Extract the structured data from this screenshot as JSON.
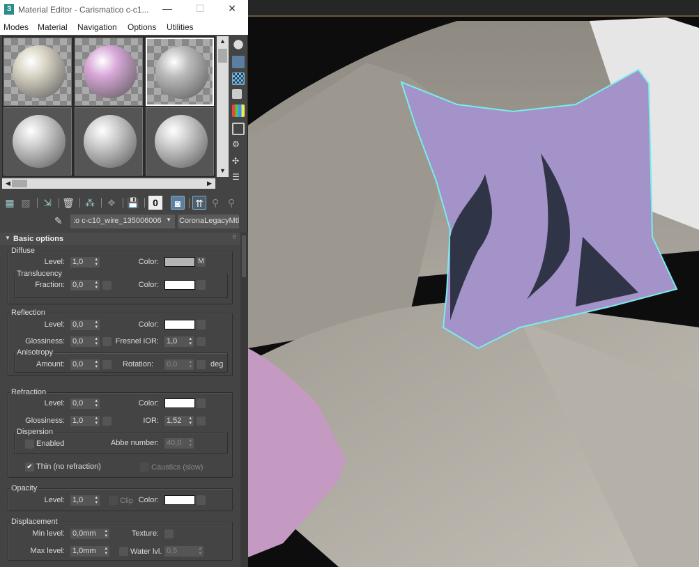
{
  "window": {
    "app_icon": "3",
    "title": "Material Editor - Carismatico c-c1...",
    "minimize": "—",
    "maximize": "☐",
    "close": "✕"
  },
  "menu": [
    "Modes",
    "Material",
    "Navigation",
    "Options",
    "Utilities"
  ],
  "slots": [
    {
      "color": "#d8d4c4"
    },
    {
      "color": "#d8a8d8"
    },
    {
      "color": "#bbbbbb"
    },
    {
      "color": "#cfcfcf"
    },
    {
      "color": "#cfcfcf"
    },
    {
      "color": "#cfcfcf"
    }
  ],
  "material": {
    "name": ":o c-c10_wire_135006006",
    "type": "CoronaLegacyMtl"
  },
  "rollout": {
    "title": "Basic options"
  },
  "diffuse": {
    "title": "Diffuse",
    "level_label": "Level:",
    "level": "1,0",
    "color_label": "Color:",
    "color": "#b4b4b4",
    "map_button": "M",
    "translucency": {
      "title": "Translucency",
      "fraction_label": "Fraction:",
      "fraction": "0,0",
      "color_label": "Color:",
      "color": "#ffffff"
    }
  },
  "reflection": {
    "title": "Reflection",
    "level_label": "Level:",
    "level": "0,0",
    "color_label": "Color:",
    "color": "#ffffff",
    "glossiness_label": "Glossiness:",
    "glossiness": "0,0",
    "fresnel_label": "Fresnel IOR:",
    "fresnel": "1,0",
    "anisotropy": {
      "title": "Anisotropy",
      "amount_label": "Amount:",
      "amount": "0,0",
      "rotation_label": "Rotation:",
      "rotation": "0,0",
      "unit": "deg"
    }
  },
  "refraction": {
    "title": "Refraction",
    "level_label": "Level:",
    "level": "0,0",
    "color_label": "Color:",
    "color": "#ffffff",
    "glossiness_label": "Glossiness:",
    "glossiness": "1,0",
    "ior_label": "IOR:",
    "ior": "1,52",
    "dispersion": {
      "title": "Dispersion",
      "enabled_label": "Enabled",
      "enabled": false,
      "abbe_label": "Abbe number:",
      "abbe": "40,0"
    },
    "thin_label": "Thin (no refraction)",
    "thin": true,
    "caustics_label": "Caustics (slow)"
  },
  "opacity": {
    "title": "Opacity",
    "level_label": "Level:",
    "level": "1,0",
    "clip_label": "Clip",
    "color_label": "Color:",
    "color": "#ffffff"
  },
  "displacement": {
    "title": "Displacement",
    "min_label": "Min level:",
    "min": "0,0mm",
    "texture_label": "Texture:",
    "max_label": "Max level:",
    "max": "1,0mm",
    "water_label": "Water lvl.",
    "water": "0,5"
  }
}
